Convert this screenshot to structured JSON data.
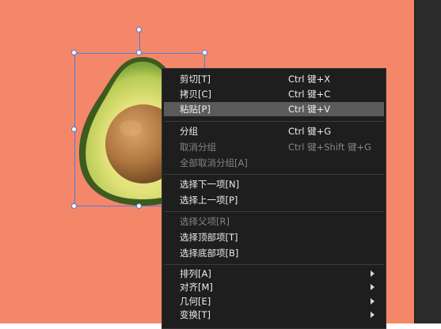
{
  "colors": {
    "canvas_bg": "#f4876a",
    "menu_bg": "#1e1e1e",
    "highlight": "#5b5b5b",
    "selection": "#4a7fd8"
  },
  "canvas": {
    "object": "avocado-half-image",
    "selected": true
  },
  "context_menu": {
    "items": [
      {
        "label": "剪切[T]",
        "shortcut": "Ctrl 键+X",
        "enabled": true,
        "highlighted": false
      },
      {
        "label": "拷贝[C]",
        "shortcut": "Ctrl 键+C",
        "enabled": true,
        "highlighted": false
      },
      {
        "label": "粘贴[P]",
        "shortcut": "Ctrl 键+V",
        "enabled": true,
        "highlighted": true
      },
      {
        "label": "分组",
        "shortcut": "Ctrl 键+G",
        "enabled": true,
        "highlighted": false
      },
      {
        "label": "取消分组",
        "shortcut": "Ctrl 键+Shift 键+G",
        "enabled": false,
        "highlighted": false
      },
      {
        "label": "全部取消分组[A]",
        "shortcut": "",
        "enabled": false,
        "highlighted": false
      },
      {
        "label": "选择下一项[N]",
        "shortcut": "",
        "enabled": true,
        "highlighted": false
      },
      {
        "label": "选择上一项[P]",
        "shortcut": "",
        "enabled": true,
        "highlighted": false
      },
      {
        "label": "选择父项[R]",
        "shortcut": "",
        "enabled": false,
        "highlighted": false
      },
      {
        "label": "选择顶部项[T]",
        "shortcut": "",
        "enabled": true,
        "highlighted": false
      },
      {
        "label": "选择底部项[B]",
        "shortcut": "",
        "enabled": true,
        "highlighted": false
      },
      {
        "label": "排列[A]",
        "shortcut": "",
        "enabled": true,
        "highlighted": false,
        "submenu": true
      },
      {
        "label": "对齐[M]",
        "shortcut": "",
        "enabled": true,
        "highlighted": false,
        "submenu": true
      },
      {
        "label": "几何[E]",
        "shortcut": "",
        "enabled": true,
        "highlighted": false,
        "submenu": true
      },
      {
        "label": "变换[T]",
        "shortcut": "",
        "enabled": true,
        "highlighted": false,
        "submenu": true
      }
    ]
  }
}
